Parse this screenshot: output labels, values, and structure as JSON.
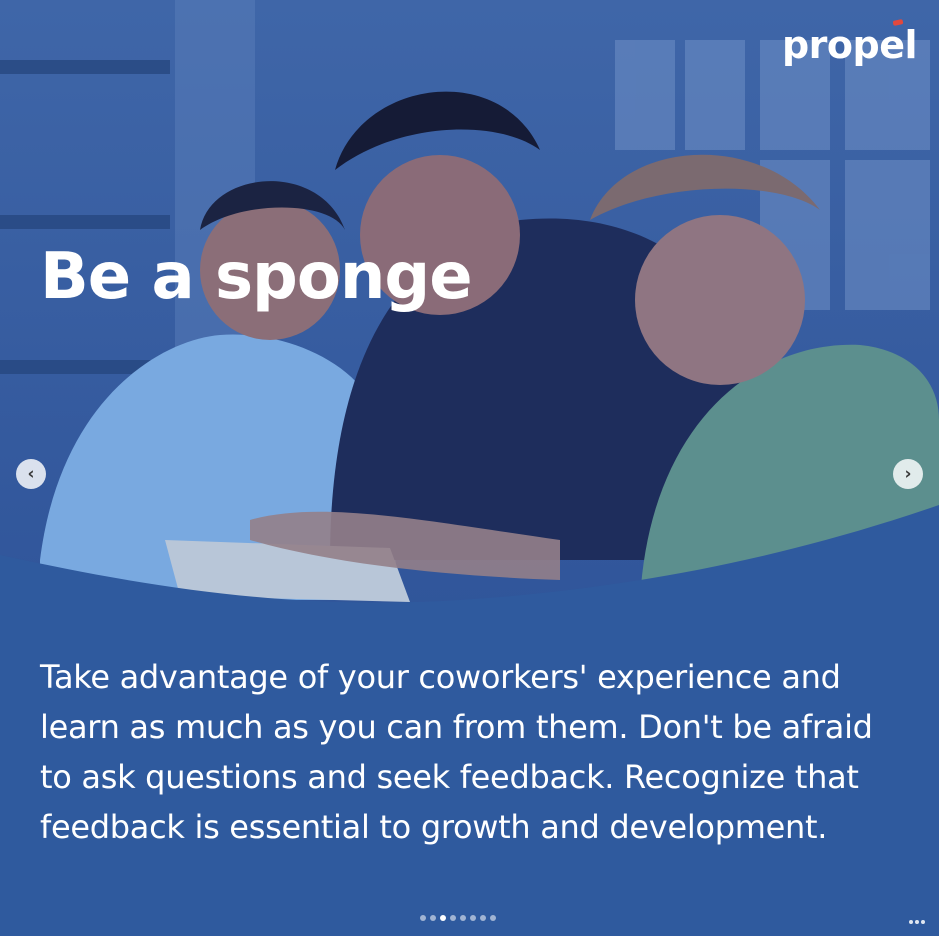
{
  "post": {
    "brand": "propel",
    "headline": "Be a sponge",
    "body": "Take advantage of your coworkers' experience and learn as much as you can from them. Don't be afraid to ask questions and seek feedback. Recognize that feedback is essential to growth and development."
  },
  "carousel": {
    "prev_icon": "chevron-left-icon",
    "next_icon": "chevron-right-icon",
    "prev_glyph": "‹",
    "next_glyph": "›",
    "slide_count": 8,
    "active_index": 2
  },
  "colors": {
    "brand_blue": "#2f5a9e",
    "accent_red": "#e2483d",
    "text": "#ffffff"
  }
}
